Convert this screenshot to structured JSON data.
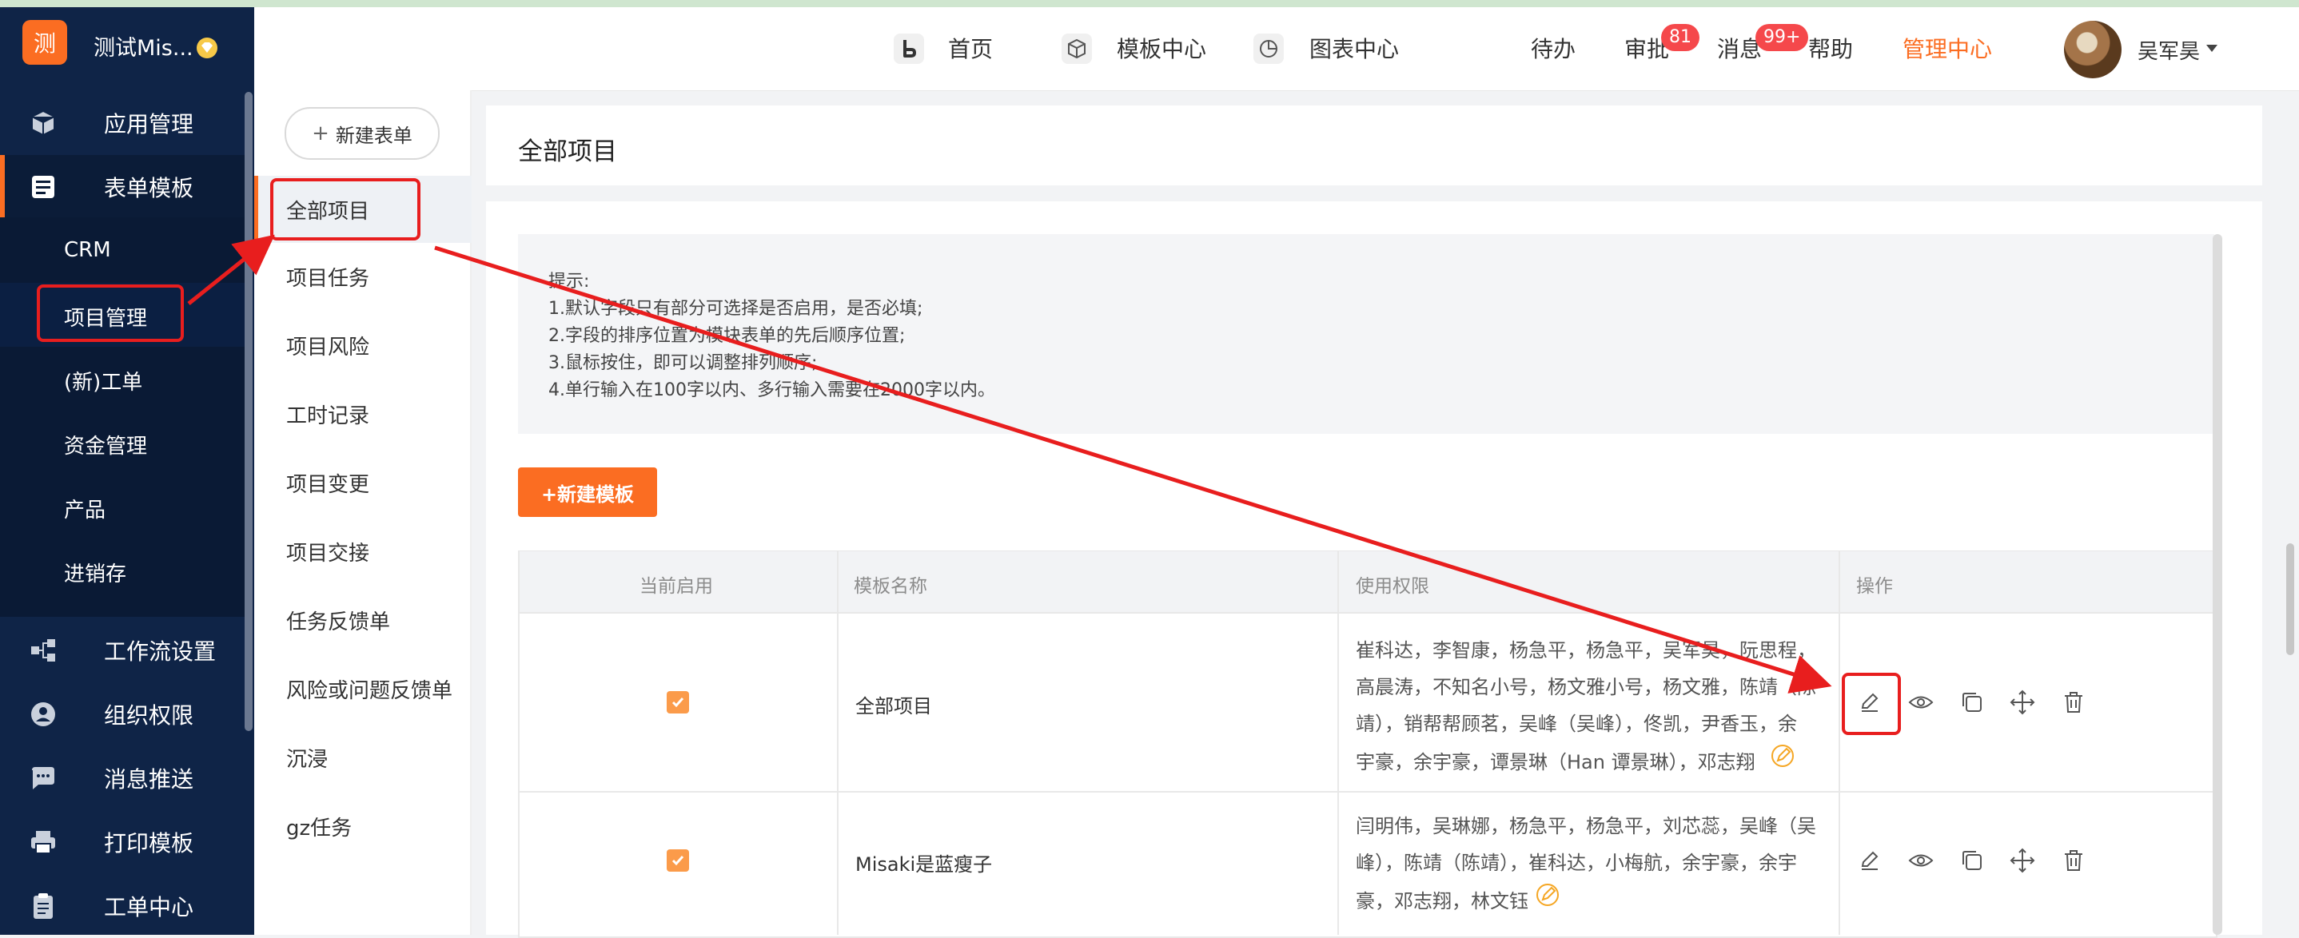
{
  "app": {
    "brand_initial": "测",
    "brand_name": "测试Mis..."
  },
  "sidebar": {
    "items": [
      {
        "label": "应用管理",
        "icon": "cube-icon"
      },
      {
        "label": "表单模板",
        "icon": "form-icon"
      },
      {
        "label": "工作流设置",
        "icon": "workflow-icon"
      },
      {
        "label": "组织权限",
        "icon": "user-circle-icon"
      },
      {
        "label": "消息推送",
        "icon": "chat-icon"
      },
      {
        "label": "打印模板",
        "icon": "printer-icon"
      },
      {
        "label": "工单中心",
        "icon": "clipboard-icon"
      }
    ],
    "sub_items": [
      "CRM",
      "项目管理",
      "(新)工单",
      "资金管理",
      "产品",
      "进销存"
    ]
  },
  "header": {
    "nav": [
      {
        "label": "首页",
        "icon": "home-b-icon"
      },
      {
        "label": "模板中心",
        "icon": "box-icon"
      },
      {
        "label": "图表中心",
        "icon": "pie-chart-icon"
      }
    ],
    "links": {
      "todo": "待办",
      "approve": "审批",
      "approve_badge": "81",
      "message": "消息",
      "message_badge": "99+",
      "help": "帮助",
      "admin": "管理中心"
    },
    "user_name": "吴军昊",
    "accent_color": "#fb6d22"
  },
  "form_list": {
    "new_button": "新建表单",
    "items": [
      "全部项目",
      "项目任务",
      "项目风险",
      "工时记录",
      "项目变更",
      "项目交接",
      "任务反馈单",
      "风险或问题反馈单",
      "沉浸",
      "gz任务"
    ]
  },
  "main": {
    "title": "全部项目",
    "tips": [
      "提示:",
      "1.默认字段只有部分可选择是否启用，是否必填;",
      "2.字段的排序位置为模块表单的先后顺序位置;",
      "3.鼠标按住，即可以调整排列顺序;",
      "4.单行输入在100字以内、多行输入需要在2000字以内。"
    ],
    "new_template_button": "+新建模板",
    "table": {
      "headers": [
        "当前启用",
        "模板名称",
        "使用权限",
        "操作"
      ],
      "rows": [
        {
          "enabled": true,
          "name": "全部项目",
          "permission_lines": [
            "崔科达，李智康，杨急平，杨急平，吴军昊，阮思程，",
            "高晨涛，不知名小号，杨文雅小号，杨文雅，陈靖（陈",
            "靖），销帮帮顾茗，吴峰（吴峰），佟凯，尹香玉，余",
            "宇豪，余宇豪，谭景琳（Han 谭景琳），邓志翔"
          ]
        },
        {
          "enabled": true,
          "name": "Misaki是蓝瘦子",
          "permission_lines": [
            "闫明伟，吴琳娜，杨急平，杨急平，刘芯蕊，吴峰（吴",
            "峰），陈靖（陈靖），崔科达，小梅航，余宇豪，余宇",
            "豪，邓志翔，林文钰"
          ]
        }
      ],
      "operations": [
        "edit-icon",
        "view-icon",
        "copy-icon",
        "move-icon",
        "delete-icon"
      ]
    }
  }
}
